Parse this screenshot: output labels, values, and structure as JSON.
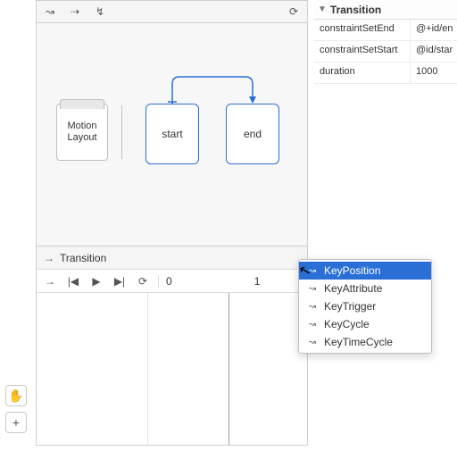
{
  "toolbar": {
    "icon_create_transition": "↝",
    "icon_create_constraintset": "⇢",
    "icon_create_click": "↯",
    "icon_cycle": "⟳"
  },
  "canvas": {
    "motion_layout_label": "Motion\nLayout",
    "start_label": "start",
    "end_label": "end"
  },
  "timeline": {
    "title": "Transition",
    "arrow": "→",
    "tick0": "0",
    "tick1": "1",
    "ctrl_goto": "→",
    "ctrl_prev": "|◀",
    "ctrl_play": "▶",
    "ctrl_next": "▶|",
    "ctrl_loop": "⟳"
  },
  "attrs": {
    "header": "Transition",
    "rows": [
      {
        "k": "constraintSetEnd",
        "v": "@+id/en"
      },
      {
        "k": "constraintSetStart",
        "v": "@id/star"
      },
      {
        "k": "duration",
        "v": "1000"
      }
    ]
  },
  "menu": {
    "items": [
      {
        "label": "KeyPosition",
        "selected": true
      },
      {
        "label": "KeyAttribute",
        "selected": false
      },
      {
        "label": "KeyTrigger",
        "selected": false
      },
      {
        "label": "KeyCycle",
        "selected": false
      },
      {
        "label": "KeyTimeCycle",
        "selected": false
      }
    ]
  },
  "left": {
    "pan": "✋",
    "plus": "+"
  }
}
